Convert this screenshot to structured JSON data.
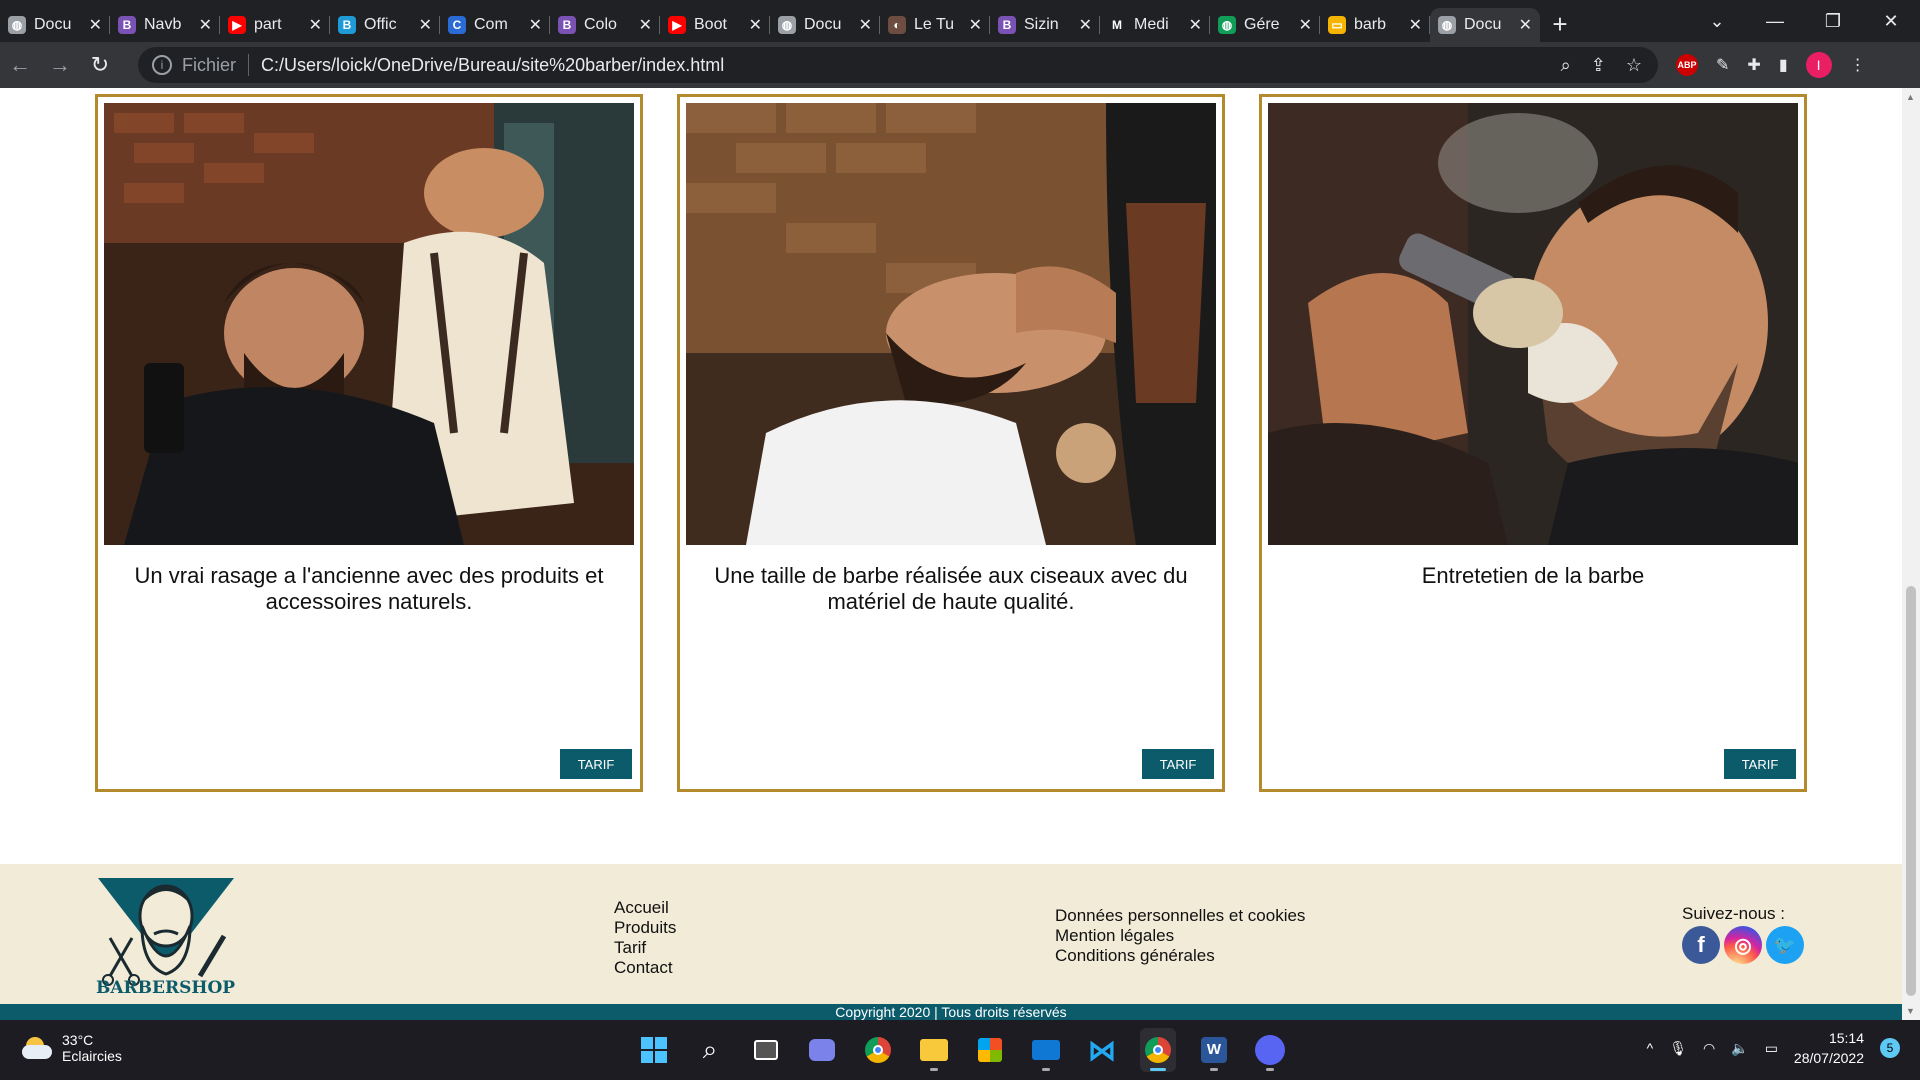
{
  "browser": {
    "tabs": [
      {
        "title": "Docu",
        "icon": "globe-icon",
        "color": "#9aa0a6",
        "glyph": "◍"
      },
      {
        "title": "Navb",
        "icon": "bootstrap-icon",
        "color": "#7952b3",
        "glyph": "B"
      },
      {
        "title": "part",
        "icon": "youtube-icon",
        "color": "#ff0000",
        "glyph": "▶"
      },
      {
        "title": "Offic",
        "icon": "bootstrap-icon",
        "color": "#1e9bd7",
        "glyph": "B"
      },
      {
        "title": "Com",
        "icon": "c-icon",
        "color": "#2b6bd6",
        "glyph": "C"
      },
      {
        "title": "Colo",
        "icon": "bootstrap-icon",
        "color": "#7952b3",
        "glyph": "B"
      },
      {
        "title": "Boot",
        "icon": "youtube-icon",
        "color": "#ff0000",
        "glyph": "▶"
      },
      {
        "title": "Docu",
        "icon": "globe-icon",
        "color": "#9aa0a6",
        "glyph": "◍"
      },
      {
        "title": "Le Tu",
        "icon": "avatar-icon",
        "color": "#6d4c41",
        "glyph": "◐"
      },
      {
        "title": "Sizin",
        "icon": "bootstrap-icon",
        "color": "#7952b3",
        "glyph": "B"
      },
      {
        "title": "Medi",
        "icon": "mdn-icon",
        "color": "#202124",
        "glyph": "M"
      },
      {
        "title": "Gére",
        "icon": "globe-green-icon",
        "color": "#0f9d58",
        "glyph": "◍"
      },
      {
        "title": "barb",
        "icon": "slides-icon",
        "color": "#f4b400",
        "glyph": "▭"
      },
      {
        "title": "Docu",
        "icon": "globe-icon",
        "color": "#9aa0a6",
        "glyph": "◍",
        "active": true
      }
    ],
    "address": {
      "scheme": "Fichier",
      "url": "C:/Users/loick/OneDrive/Bureau/site%20barber/index.html"
    },
    "profile_initial": "I",
    "abp_label": "ABP"
  },
  "cards": [
    {
      "caption": "Un vrai rasage a l'ancienne avec des produits et accessoires naturels.",
      "button": "TARIF",
      "photo": "barber-trimming-beard"
    },
    {
      "caption": "Une taille de barbe réalisée aux ciseaux avec du matériel de haute qualité.",
      "button": "TARIF",
      "photo": "barber-face-massage"
    },
    {
      "caption": "Entretetien de la barbe",
      "button": "TARIF",
      "photo": "shaving-brush-beard"
    }
  ],
  "footer": {
    "logo_text": "BARBERSHOP",
    "nav": [
      "Accueil",
      "Produits",
      "Tarif",
      "Contact"
    ],
    "legal": [
      "Données personnelles et cookies",
      "Mention légales",
      "Conditions générales"
    ],
    "social_label": "Suivez-nous :",
    "socials": [
      {
        "name": "facebook",
        "glyph": "f",
        "color": "#3b5998"
      },
      {
        "name": "instagram",
        "glyph": "◎",
        "color": "#d6249f"
      },
      {
        "name": "twitter",
        "glyph": "🐦",
        "color": "#1da1f2"
      }
    ],
    "copyright": "Copyright 2020 | Tous droits réservés"
  },
  "taskbar": {
    "weather_temp": "33°C",
    "weather_desc": "Eclaircies",
    "time": "15:14",
    "date": "28/07/2022",
    "notifications": "5"
  },
  "colors": {
    "card_border": "#b38b2d",
    "button_bg": "#0b5b6b",
    "footer_bg": "#f1ebd7"
  }
}
